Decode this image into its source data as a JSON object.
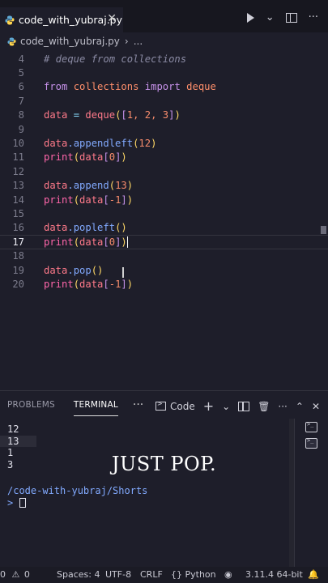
{
  "tab": {
    "filename": "code_with_yubraj.py",
    "close": "✕"
  },
  "breadcrumb": {
    "file": "code_with_yubraj.py",
    "sep": "›",
    "more": "..."
  },
  "editor": {
    "lines": [
      {
        "n": "4"
      },
      {
        "n": "5"
      },
      {
        "n": "6"
      },
      {
        "n": "7"
      },
      {
        "n": "8"
      },
      {
        "n": "9"
      },
      {
        "n": "10"
      },
      {
        "n": "11"
      },
      {
        "n": "12"
      },
      {
        "n": "13"
      },
      {
        "n": "14"
      },
      {
        "n": "15"
      },
      {
        "n": "16"
      },
      {
        "n": "17"
      },
      {
        "n": "18"
      },
      {
        "n": "19"
      },
      {
        "n": "20"
      }
    ],
    "code": {
      "l4": "# deque from collections",
      "l6_from": "from",
      "l6_mod": "collections",
      "l6_import": "import",
      "l6_name": "deque",
      "l8_var": "data",
      "l8_eq": " = ",
      "l8_fn": "deque",
      "l8_args": "1, 2, 3",
      "l10_var": "data",
      "l10_fn": ".appendleft",
      "l10_arg": "12",
      "l11_print": "print",
      "l11_var": "data",
      "l11_idx": "0",
      "l13_var": "data",
      "l13_fn": ".append",
      "l13_arg": "13",
      "l14_print": "print",
      "l14_var": "data",
      "l14_idx": "-1",
      "l16_var": "data",
      "l16_fn": ".popleft",
      "l17_print": "print",
      "l17_var": "data",
      "l17_idx": "0",
      "l19_var": "data",
      "l19_fn": ".pop",
      "l20_print": "print",
      "l20_var": "data",
      "l20_idx": "-1"
    }
  },
  "panel": {
    "tabs": [
      "PROBLEMS",
      "TERMINAL"
    ],
    "more": "···",
    "terminal_name": "Code",
    "output": [
      "12",
      "13",
      "1",
      "3"
    ],
    "path": "/code-with-yubraj/Shorts",
    "prompt": ">"
  },
  "caption": "JUST POP.",
  "status": {
    "problems": "0",
    "warnings": "0",
    "spaces": "Spaces: 4",
    "encoding": "UTF-8",
    "eol": "CRLF",
    "language": "{} Python",
    "interpreter": "3.11.4 64-bit"
  },
  "colors": {
    "accent": "#82aaff",
    "background": "#1e1e2a"
  },
  "icons": [
    "python-file-icon",
    "close-icon",
    "run-icon",
    "split-editor-icon",
    "terminal-icon",
    "add-icon",
    "trash-icon",
    "chevron-up-icon",
    "bell-icon"
  ]
}
